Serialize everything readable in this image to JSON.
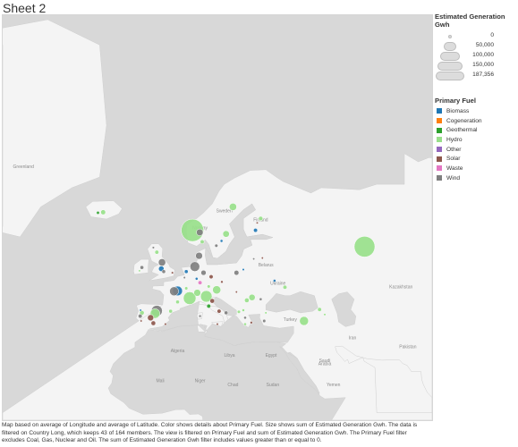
{
  "sheet_title": "Sheet 2",
  "map": {
    "labels": [
      {
        "text": "Greenland",
        "lon": -42,
        "lat": 71.2
      },
      {
        "text": "Sweden",
        "lon": 16,
        "lat": 64.6
      },
      {
        "text": "Finland",
        "lon": 26.5,
        "lat": 63
      },
      {
        "text": "Norway",
        "lon": 9,
        "lat": 61.5
      },
      {
        "text": "Belarus",
        "lon": 28,
        "lat": 53.6
      },
      {
        "text": "Ukraine",
        "lon": 31.5,
        "lat": 49
      },
      {
        "text": "Kazakhstan",
        "lon": 67,
        "lat": 48
      },
      {
        "text": "Turkey",
        "lon": 35,
        "lat": 38.5
      },
      {
        "text": "Iran",
        "lon": 53,
        "lat": 32.5
      },
      {
        "text": "Pakistan",
        "lon": 69,
        "lat": 29.5
      },
      {
        "text": "Algeria",
        "lon": 2.5,
        "lat": 28
      },
      {
        "text": "Libya",
        "lon": 17.5,
        "lat": 26.5
      },
      {
        "text": "Egypt",
        "lon": 29.5,
        "lat": 26.5
      },
      {
        "text": "Saudi",
        "lon": 45,
        "lat": 24.5
      },
      {
        "text": "Arabia",
        "lon": 45,
        "lat": 23.3
      },
      {
        "text": "Mali",
        "lon": -2.5,
        "lat": 17
      },
      {
        "text": "Niger",
        "lon": 9,
        "lat": 17
      },
      {
        "text": "Chad",
        "lon": 18.5,
        "lat": 15.5
      },
      {
        "text": "Sudan",
        "lon": 30,
        "lat": 15.5
      },
      {
        "text": "Yemen",
        "lon": 47.5,
        "lat": 15.5
      }
    ]
  },
  "legend": {
    "size_title": "Estimated Generation Gwh",
    "size_values": [
      "0",
      "50,000",
      "100,000",
      "150,000",
      "187,356"
    ],
    "fuel_title": "Primary Fuel",
    "fuels": [
      {
        "label": "Biomass",
        "color": "#1f77b4"
      },
      {
        "label": "Cogeneration",
        "color": "#ff7f0e"
      },
      {
        "label": "Geothermal",
        "color": "#2ca02c"
      },
      {
        "label": "Hydro",
        "color": "#98df8a"
      },
      {
        "label": "Other",
        "color": "#9467bd"
      },
      {
        "label": "Solar",
        "color": "#8c564b"
      },
      {
        "label": "Waste",
        "color": "#e377c2"
      },
      {
        "label": "Wind",
        "color": "#7f7f7f"
      }
    ]
  },
  "caption": "Map based on average of Longitude and average of Latitude.  Color shows details about Primary Fuel.  Size shows sum of Estimated Generation Gwh. The data is filtered on Country Long, which keeps 43 of 164 members. The view is filtered on Primary Fuel and sum of Estimated Generation Gwh. The Primary Fuel filter excludes Coal, Gas, Nuclear and Oil. The sum of Estimated Generation Gwh filter includes values greater than or equal to 0.",
  "points": [
    {
      "lon": -19,
      "lat": 64.6,
      "fuel": "Hydro",
      "gwh": 9000
    },
    {
      "lon": -20.5,
      "lat": 64.5,
      "fuel": "Geothermal",
      "gwh": 3500
    },
    {
      "lon": 6.8,
      "lat": 61.3,
      "fuel": "Hydro",
      "gwh": 187356
    },
    {
      "lon": 8.9,
      "lat": 60.9,
      "fuel": "Wind",
      "gwh": 17000
    },
    {
      "lon": 9.6,
      "lat": 59.0,
      "fuel": "Hydro",
      "gwh": 6000
    },
    {
      "lon": 18.5,
      "lat": 65.5,
      "fuel": "Hydro",
      "gwh": 20000
    },
    {
      "lon": 16.5,
      "lat": 60.6,
      "fuel": "Hydro",
      "gwh": 16000
    },
    {
      "lon": 15.2,
      "lat": 59.2,
      "fuel": "Biomass",
      "gwh": 3000
    },
    {
      "lon": 13.7,
      "lat": 58.2,
      "fuel": "Wind",
      "gwh": 4000
    },
    {
      "lon": 26.5,
      "lat": 63.5,
      "fuel": "Hydro",
      "gwh": 7000
    },
    {
      "lon": 25.0,
      "lat": 61.3,
      "fuel": "Biomass",
      "gwh": 6000
    },
    {
      "lon": 25.5,
      "lat": 62.7,
      "fuel": "Solar",
      "gwh": 800
    },
    {
      "lon": 56.5,
      "lat": 58.0,
      "fuel": "Hydro",
      "gwh": 160000
    },
    {
      "lon": -3.5,
      "lat": 56.8,
      "fuel": "Hydro",
      "gwh": 6000
    },
    {
      "lon": -4.5,
      "lat": 57.8,
      "fuel": "Wind",
      "gwh": 2000
    },
    {
      "lon": -2.0,
      "lat": 54.5,
      "fuel": "Wind",
      "gwh": 20000
    },
    {
      "lon": -2.2,
      "lat": 53.0,
      "fuel": "Biomass",
      "gwh": 11000
    },
    {
      "lon": -1.5,
      "lat": 52.3,
      "fuel": "Wind",
      "gwh": 5000
    },
    {
      "lon": 1.0,
      "lat": 52.0,
      "fuel": "Solar",
      "gwh": 2000
    },
    {
      "lon": -7.8,
      "lat": 53.3,
      "fuel": "Wind",
      "gwh": 5000
    },
    {
      "lon": -8.5,
      "lat": 52.5,
      "fuel": "Hydro",
      "gwh": 1500
    },
    {
      "lon": 8.7,
      "lat": 56.0,
      "fuel": "Wind",
      "gwh": 18000
    },
    {
      "lon": 7.5,
      "lat": 53.5,
      "fuel": "Wind",
      "gwh": 35000
    },
    {
      "lon": 10.0,
      "lat": 52.0,
      "fuel": "Wind",
      "gwh": 10000
    },
    {
      "lon": 12.2,
      "lat": 51.0,
      "fuel": "Solar",
      "gwh": 6000
    },
    {
      "lon": 9.0,
      "lat": 49.5,
      "fuel": "Waste",
      "gwh": 6000
    },
    {
      "lon": 11.5,
      "lat": 48.5,
      "fuel": "Hydro",
      "gwh": 4000
    },
    {
      "lon": 8.0,
      "lat": 50.5,
      "fuel": "Biomass",
      "gwh": 3000
    },
    {
      "lon": 5.0,
      "lat": 52.3,
      "fuel": "Biomass",
      "gwh": 5000
    },
    {
      "lon": 4.5,
      "lat": 50.8,
      "fuel": "Wind",
      "gwh": 2000
    },
    {
      "lon": 2.5,
      "lat": 47.3,
      "fuel": "Biomass",
      "gwh": 35000
    },
    {
      "lon": 1.5,
      "lat": 47.2,
      "fuel": "Wind",
      "gwh": 30000
    },
    {
      "lon": 6.0,
      "lat": 45.3,
      "fuel": "Hydro",
      "gwh": 60000
    },
    {
      "lon": 2.5,
      "lat": 44.2,
      "fuel": "Hydro",
      "gwh": 5000
    },
    {
      "lon": 5.0,
      "lat": 48.0,
      "fuel": "Hydro",
      "gwh": 4000
    },
    {
      "lon": 8.2,
      "lat": 46.8,
      "fuel": "Hydro",
      "gwh": 18000
    },
    {
      "lon": 13.8,
      "lat": 47.6,
      "fuel": "Hydro",
      "gwh": 25000
    },
    {
      "lon": 15.3,
      "lat": 49.7,
      "fuel": "Solar",
      "gwh": 2500
    },
    {
      "lon": 19.5,
      "lat": 52.0,
      "fuel": "Wind",
      "gwh": 9000
    },
    {
      "lon": 21.5,
      "lat": 52.8,
      "fuel": "Biomass",
      "gwh": 2000
    },
    {
      "lon": 27.0,
      "lat": 55.5,
      "fuel": "Solar",
      "gwh": 1000
    },
    {
      "lon": 24.5,
      "lat": 55.3,
      "fuel": "Wind",
      "gwh": 1000
    },
    {
      "lon": 30.5,
      "lat": 50.0,
      "fuel": "Biomass",
      "gwh": 3000
    },
    {
      "lon": 33.5,
      "lat": 48.3,
      "fuel": "Hydro",
      "gwh": 6000
    },
    {
      "lon": 24.0,
      "lat": 45.5,
      "fuel": "Hydro",
      "gwh": 15000
    },
    {
      "lon": 22.5,
      "lat": 44.7,
      "fuel": "Hydro",
      "gwh": 8000
    },
    {
      "lon": 26.5,
      "lat": 45.0,
      "fuel": "Wind",
      "gwh": 3000
    },
    {
      "lon": 19.5,
      "lat": 47.0,
      "fuel": "Solar",
      "gwh": 1000
    },
    {
      "lon": 21.5,
      "lat": 41.8,
      "fuel": "Hydro",
      "gwh": 3000
    },
    {
      "lon": 20.2,
      "lat": 41.3,
      "fuel": "Hydro",
      "gwh": 4000
    },
    {
      "lon": 22.0,
      "lat": 39.5,
      "fuel": "Wind",
      "gwh": 3000
    },
    {
      "lon": 23.8,
      "lat": 38.0,
      "fuel": "Solar",
      "gwh": 2500
    },
    {
      "lon": 22.0,
      "lat": 37.5,
      "fuel": "Hydro",
      "gwh": 3000
    },
    {
      "lon": 27.5,
      "lat": 38.5,
      "fuel": "Wind",
      "gwh": 4000
    },
    {
      "lon": 28.0,
      "lat": 41.0,
      "fuel": "Hydro",
      "gwh": 2000
    },
    {
      "lon": 39.0,
      "lat": 38.5,
      "fuel": "Hydro",
      "gwh": 30000
    },
    {
      "lon": 43.5,
      "lat": 42.0,
      "fuel": "Hydro",
      "gwh": 6000
    },
    {
      "lon": 45.0,
      "lat": 40.5,
      "fuel": "Hydro",
      "gwh": 2000
    },
    {
      "lon": 10.8,
      "lat": 45.8,
      "fuel": "Hydro",
      "gwh": 50000
    },
    {
      "lon": 11.5,
      "lat": 43.0,
      "fuel": "Geothermal",
      "gwh": 6000
    },
    {
      "lon": 12.5,
      "lat": 44.5,
      "fuel": "Solar",
      "gwh": 8000
    },
    {
      "lon": 14.5,
      "lat": 41.5,
      "fuel": "Solar",
      "gwh": 6000
    },
    {
      "lon": 16.5,
      "lat": 41.0,
      "fuel": "Wind",
      "gwh": 5000
    },
    {
      "lon": 14.0,
      "lat": 37.5,
      "fuel": "Solar",
      "gwh": 2000
    },
    {
      "lon": 9.0,
      "lat": 40.0,
      "fuel": "Wind",
      "gwh": 2500
    },
    {
      "lon": -4.0,
      "lat": 40.8,
      "fuel": "Hydro",
      "gwh": 35000
    },
    {
      "lon": -3.5,
      "lat": 41.6,
      "fuel": "Wind",
      "gwh": 45000
    },
    {
      "lon": -5.3,
      "lat": 39.5,
      "fuel": "Solar",
      "gwh": 14000
    },
    {
      "lon": -4.5,
      "lat": 37.8,
      "fuel": "Solar",
      "gwh": 8000
    },
    {
      "lon": -7.8,
      "lat": 41.0,
      "fuel": "Hydro",
      "gwh": 8000
    },
    {
      "lon": -8.3,
      "lat": 40.0,
      "fuel": "Wind",
      "gwh": 6000
    },
    {
      "lon": -8.0,
      "lat": 38.5,
      "fuel": "Solar",
      "gwh": 1500
    },
    {
      "lon": -8.2,
      "lat": 41.8,
      "fuel": "Biomass",
      "gwh": 1500
    },
    {
      "lon": -1.0,
      "lat": 37.5,
      "fuel": "Solar",
      "gwh": 2000
    },
    {
      "lon": 0.5,
      "lat": 41.5,
      "fuel": "Hydro",
      "gwh": 5000
    }
  ]
}
